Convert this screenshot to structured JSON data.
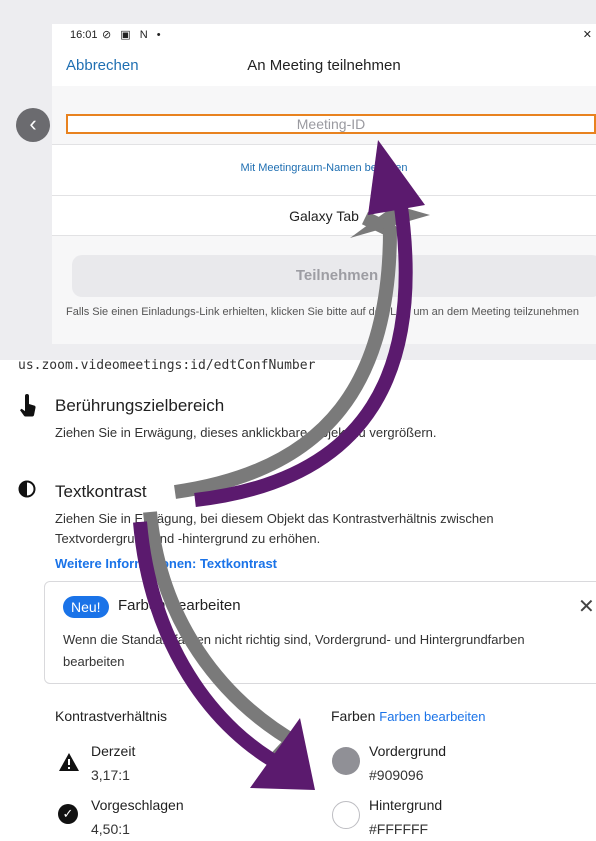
{
  "statusbar": {
    "time": "16:01",
    "icons": "⊘ ▣ N •",
    "right_icons": "✕"
  },
  "zoom": {
    "cancel_label": "Abbrechen",
    "title": "An Meeting teilnehmen",
    "meeting_id_placeholder": "Meeting-ID",
    "personal_link_label": "Mit Meetingraum-Namen beitreten",
    "display_name": "Galaxy Tab",
    "join_label": "Teilnehmen",
    "invite_note": "Falls Sie einen Einladungs-Link erhielten, klicken Sie bitte auf den Link um an dem Meeting teilzunehmen"
  },
  "back_glyph": "‹",
  "package_id": "us.zoom.videomeetings:id/edtConfNumber",
  "touch_target": {
    "title": "Berührungszielbereich",
    "desc": "Ziehen Sie in Erwägung, dieses anklickbare Objekt zu vergrößern."
  },
  "text_contrast": {
    "title": "Textkontrast",
    "desc": "Ziehen Sie in Erwägung, bei diesem Objekt das Kontrastverhältnis zwischen Textvordergrund und -hintergrund zu erhöhen.",
    "more_link": "Weitere Informationen: Textkontrast"
  },
  "card": {
    "badge": "Neu!",
    "title": "Farben bearbeiten",
    "close_glyph": "✕",
    "body": "Wenn die Standardfarben nicht richtig sind, Vordergrund- und Hintergrundfarben bearbeiten"
  },
  "contrast": {
    "heading": "Kontrastverhältnis",
    "current_label": "Derzeit",
    "current_value": "3,17:1",
    "suggested_label": "Vorgeschlagen",
    "suggested_value": "4,50:1"
  },
  "colors": {
    "heading": "Farben",
    "edit_link": "Farben bearbeiten",
    "foreground_label": "Vordergrund",
    "foreground_value": "#909096",
    "background_label": "Hintergrund",
    "background_value": "#FFFFFF"
  },
  "palette": {
    "accent": "#1a73e8",
    "arrow_purple": "#5b1a6e",
    "arrow_gray": "#7a7a7a",
    "focus_orange": "#e8821f"
  }
}
